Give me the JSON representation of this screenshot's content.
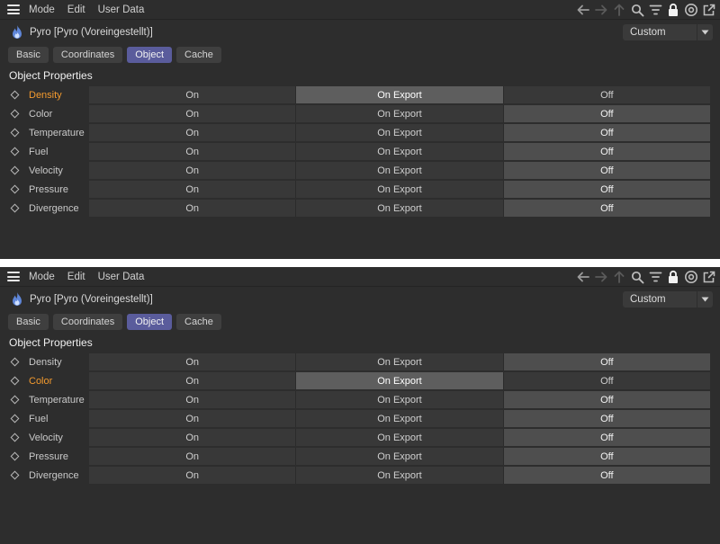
{
  "panels": [
    {
      "menubar": {
        "items": [
          "Mode",
          "Edit",
          "User Data"
        ]
      },
      "object_title": "Pyro [Pyro (Voreingestellt)]",
      "preset_dropdown": "Custom",
      "tabs": [
        {
          "label": "Basic",
          "active": false
        },
        {
          "label": "Coordinates",
          "active": false
        },
        {
          "label": "Object",
          "active": true
        },
        {
          "label": "Cache",
          "active": false
        }
      ],
      "section_title": "Object Properties",
      "rows": [
        {
          "label": "Density",
          "highlight": true,
          "options": [
            "On",
            "On Export",
            "Off"
          ],
          "selected": 1
        },
        {
          "label": "Color",
          "highlight": false,
          "options": [
            "On",
            "On Export",
            "Off"
          ],
          "selected": 2
        },
        {
          "label": "Temperature",
          "highlight": false,
          "options": [
            "On",
            "On Export",
            "Off"
          ],
          "selected": 2
        },
        {
          "label": "Fuel",
          "highlight": false,
          "options": [
            "On",
            "On Export",
            "Off"
          ],
          "selected": 2
        },
        {
          "label": "Velocity",
          "highlight": false,
          "options": [
            "On",
            "On Export",
            "Off"
          ],
          "selected": 2
        },
        {
          "label": "Pressure",
          "highlight": false,
          "options": [
            "On",
            "On Export",
            "Off"
          ],
          "selected": 2
        },
        {
          "label": "Divergence",
          "highlight": false,
          "options": [
            "On",
            "On Export",
            "Off"
          ],
          "selected": 2
        }
      ]
    },
    {
      "menubar": {
        "items": [
          "Mode",
          "Edit",
          "User Data"
        ]
      },
      "object_title": "Pyro [Pyro (Voreingestellt)]",
      "preset_dropdown": "Custom",
      "tabs": [
        {
          "label": "Basic",
          "active": false
        },
        {
          "label": "Coordinates",
          "active": false
        },
        {
          "label": "Object",
          "active": true
        },
        {
          "label": "Cache",
          "active": false
        }
      ],
      "section_title": "Object Properties",
      "rows": [
        {
          "label": "Density",
          "highlight": false,
          "options": [
            "On",
            "On Export",
            "Off"
          ],
          "selected": 2
        },
        {
          "label": "Color",
          "highlight": true,
          "options": [
            "On",
            "On Export",
            "Off"
          ],
          "selected": 1
        },
        {
          "label": "Temperature",
          "highlight": false,
          "options": [
            "On",
            "On Export",
            "Off"
          ],
          "selected": 2
        },
        {
          "label": "Fuel",
          "highlight": false,
          "options": [
            "On",
            "On Export",
            "Off"
          ],
          "selected": 2
        },
        {
          "label": "Velocity",
          "highlight": false,
          "options": [
            "On",
            "On Export",
            "Off"
          ],
          "selected": 2
        },
        {
          "label": "Pressure",
          "highlight": false,
          "options": [
            "On",
            "On Export",
            "Off"
          ],
          "selected": 2
        },
        {
          "label": "Divergence",
          "highlight": false,
          "options": [
            "On",
            "On Export",
            "Off"
          ],
          "selected": 2
        }
      ]
    }
  ],
  "toolbar_icons": [
    "arrow-left-icon",
    "arrow-right-icon",
    "arrow-up-icon",
    "search-icon",
    "filter-icon",
    "lock-icon",
    "target-icon",
    "new-window-icon"
  ],
  "colors": {
    "background": "#2d2d2d",
    "active_tab": "#5a5c9c",
    "highlight_label": "#f39a2e",
    "selected_segment": "#4e4e4e",
    "hover_selected_segment": "#5e5e5e"
  }
}
